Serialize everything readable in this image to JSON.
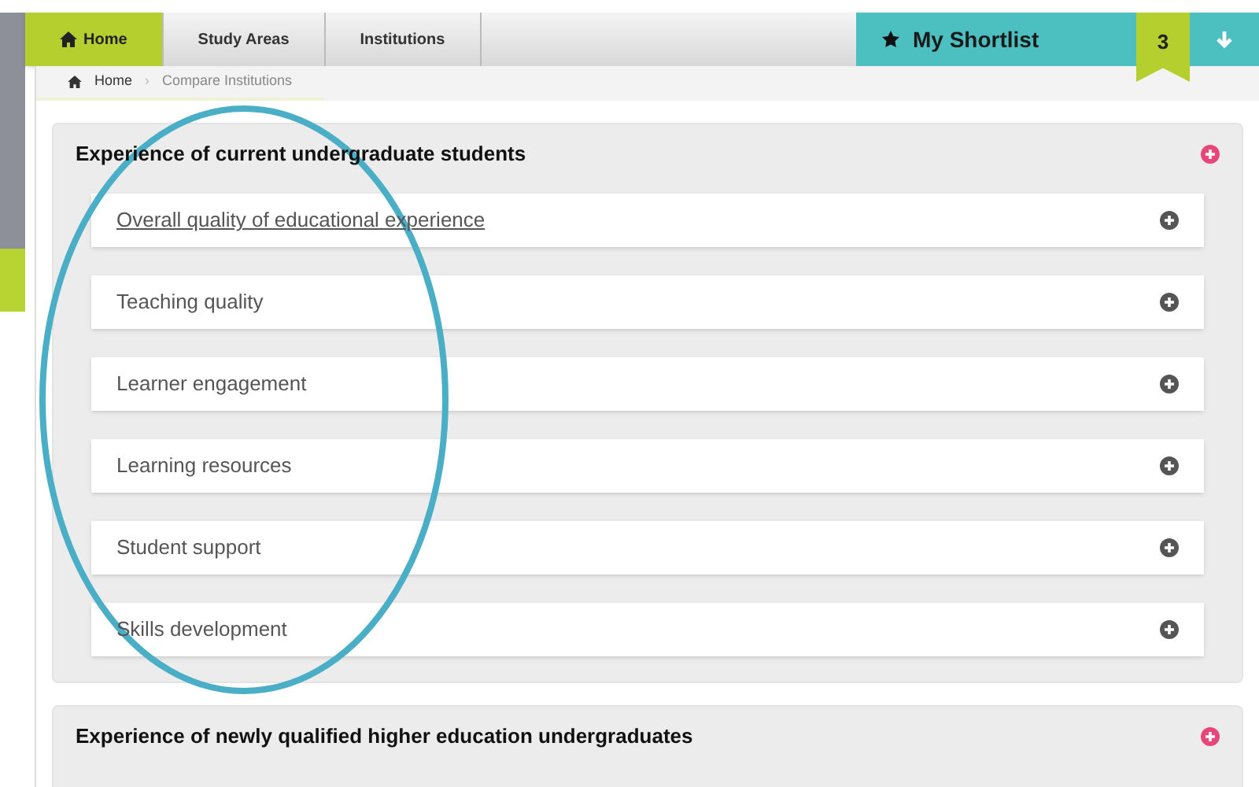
{
  "nav": {
    "tabs": [
      {
        "label": "Home",
        "selected": true
      },
      {
        "label": "Study Areas",
        "selected": false
      },
      {
        "label": "Institutions",
        "selected": false
      }
    ],
    "shortlist": {
      "label": "My Shortlist",
      "count": "3"
    }
  },
  "breadcrumb": {
    "separator": "›",
    "items": [
      "Home",
      "Compare Institutions"
    ]
  },
  "sections": [
    {
      "title": "Experience of current undergraduate students",
      "expanded": true,
      "items": [
        {
          "label": "Overall quality of educational experience",
          "link": true
        },
        {
          "label": "Teaching quality",
          "link": false
        },
        {
          "label": "Learner engagement",
          "link": false
        },
        {
          "label": "Learning resources",
          "link": false
        },
        {
          "label": "Student support",
          "link": false
        },
        {
          "label": "Skills development",
          "link": false
        }
      ]
    },
    {
      "title": "Experience of newly qualified higher education undergraduates",
      "expanded": false
    }
  ]
}
